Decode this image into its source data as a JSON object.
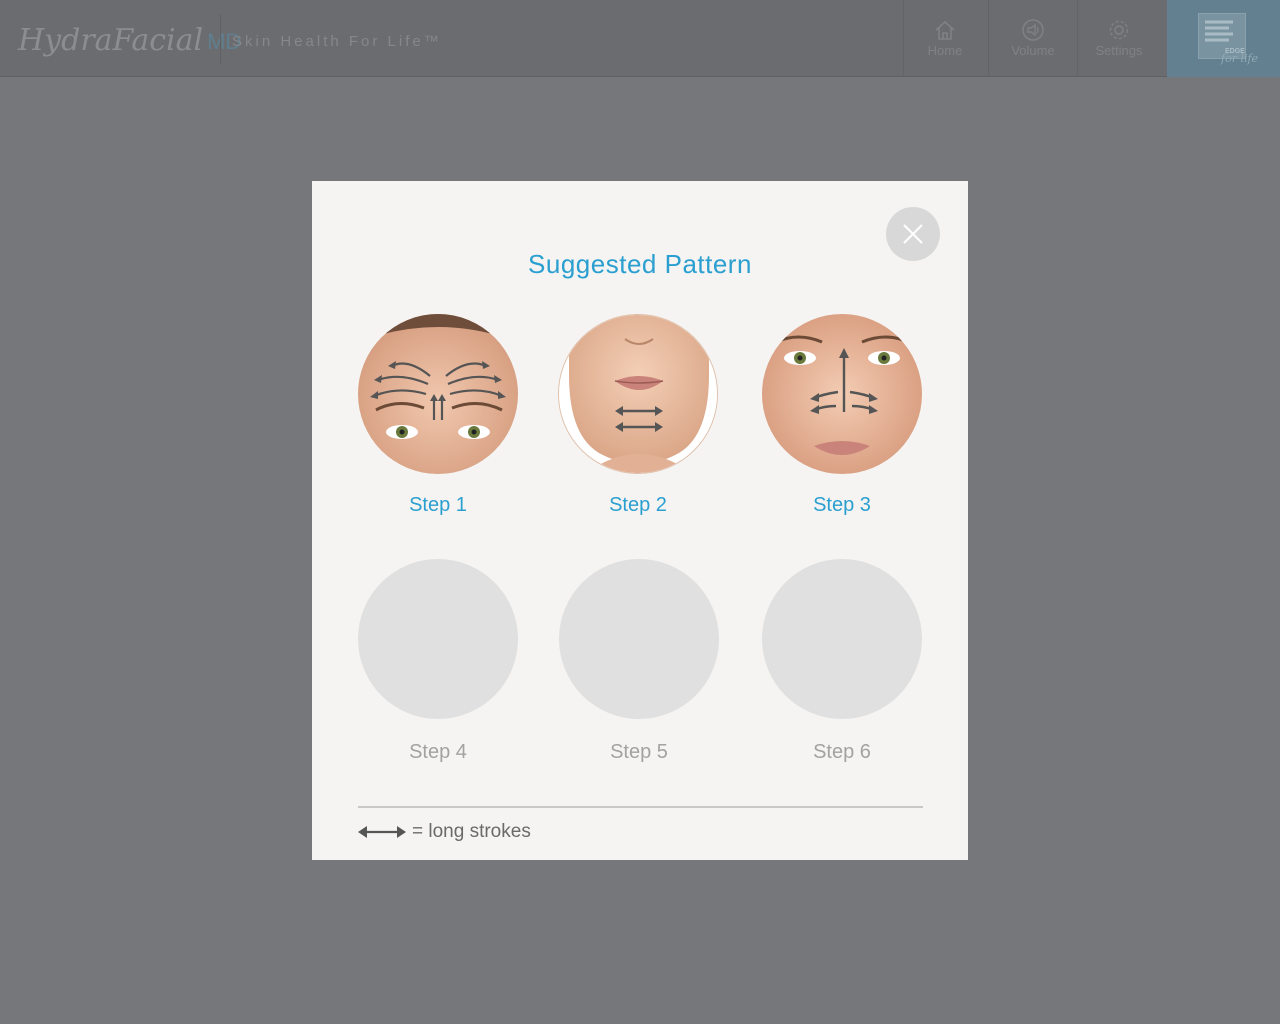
{
  "header": {
    "brand_script": "HydraFacial",
    "brand_suffix": "MD",
    "tagline": "Skin Health For Life™",
    "nav": [
      {
        "label": "Home",
        "icon": "home-icon"
      },
      {
        "label": "Volume",
        "icon": "speaker-icon"
      },
      {
        "label": "Settings",
        "icon": "gear-icon"
      }
    ],
    "edge_logo_script": "for life"
  },
  "modal": {
    "title": "Suggested Pattern",
    "steps": [
      {
        "label": "Step 1",
        "state": "active",
        "image": "forehead-pattern"
      },
      {
        "label": "Step 2",
        "state": "active",
        "image": "chin-pattern"
      },
      {
        "label": "Step 3",
        "state": "active",
        "image": "nose-cheeks-pattern"
      },
      {
        "label": "Step 4",
        "state": "inactive"
      },
      {
        "label": "Step 5",
        "state": "inactive"
      },
      {
        "label": "Step 6",
        "state": "inactive"
      }
    ],
    "legend_text": "= long strokes"
  },
  "colors": {
    "accent": "#2a9fd0",
    "overlay_bg": "#76777b",
    "modal_bg": "#f5f4f2",
    "inactive_circle": "#e0e0e0",
    "inactive_text": "#a2a2a2"
  }
}
